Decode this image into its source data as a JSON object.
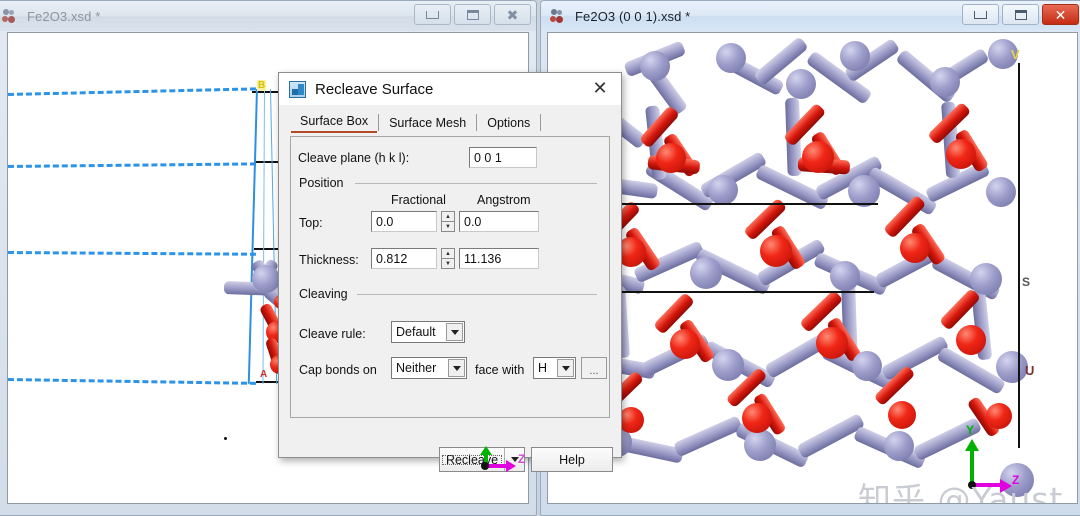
{
  "windows": {
    "left": {
      "title": "Fe2O3.xsd *",
      "icon": "molecule-icon",
      "state": "inactive",
      "buttons": {
        "minimize": "minimize-icon",
        "maximize": "restore-icon",
        "close": "close-icon"
      },
      "labels": {
        "top_vertex": "B",
        "bottom_vertex": "A"
      }
    },
    "right": {
      "title": "Fe2O3 (0 0 1).xsd *",
      "icon": "molecule-icon",
      "state": "active",
      "buttons": {
        "minimize": "minimize-icon",
        "maximize": "restore-icon",
        "close": "close-icon"
      },
      "labels": {
        "v_marker": "V",
        "u_marker": "U",
        "s_marker": "S"
      },
      "axes": {
        "y": "Y",
        "z": "Z"
      }
    }
  },
  "dialog": {
    "title": "Recleave Surface",
    "icon": "surface-icon",
    "close": "close-icon",
    "tabs": [
      {
        "label": "Surface Box",
        "selected": true
      },
      {
        "label": "Surface Mesh",
        "selected": false
      },
      {
        "label": "Options",
        "selected": false
      }
    ],
    "cleave_plane": {
      "label": "Cleave plane (h k l):",
      "value": "0  0  1",
      "placeholder": "h k l"
    },
    "position": {
      "group_label": "Position",
      "col_fractional": "Fractional",
      "col_angstrom": "Angstrom",
      "rows": [
        {
          "label": "Top:",
          "fractional": "0.0",
          "angstrom": "0.0"
        },
        {
          "label": "Thickness:",
          "fractional": "0.812",
          "angstrom": "11.136"
        }
      ]
    },
    "cleaving": {
      "group_label": "Cleaving",
      "cleave_rule": {
        "label": "Cleave rule:",
        "value": "Default"
      },
      "cap_bonds": {
        "label": "Cap bonds on",
        "value": "Neither"
      },
      "face_with": {
        "label": "face with",
        "value": "H"
      },
      "more_button": "..."
    },
    "buttons": {
      "recleave": "Recleave",
      "recleave_dropdown": "chevron-down-icon",
      "help": "Help"
    }
  },
  "watermark": "知乎 @Yaust",
  "colors": {
    "oxygen": "#e0190d",
    "iron": "#9a9ac6",
    "dash_line": "#2d93e8",
    "axis_y": "#00b200",
    "axis_z": "#e000e0",
    "tab_underline": "#b44a2a",
    "close_red": "#c62b12"
  }
}
